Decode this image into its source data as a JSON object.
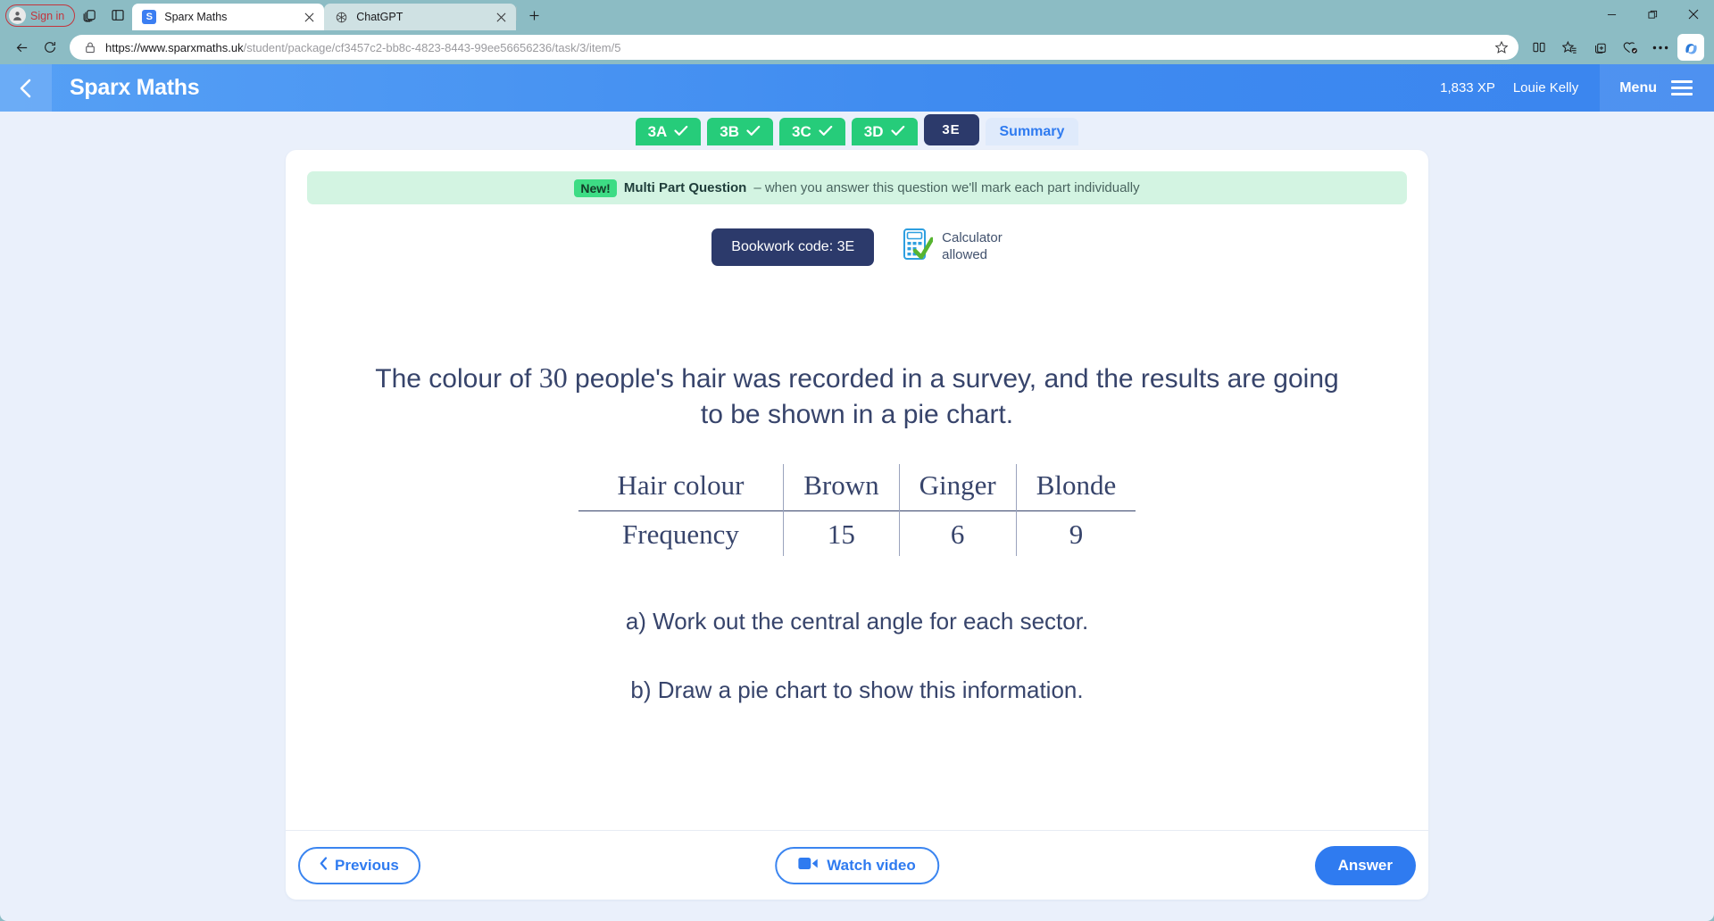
{
  "browser": {
    "signin_label": "Sign in",
    "tabs": [
      {
        "title": "Sparx Maths",
        "favicon": "sparx-s-icon",
        "active": true
      },
      {
        "title": "ChatGPT",
        "favicon": "openai-icon",
        "active": false
      }
    ],
    "url_secure": "https://www.sparxmaths.uk",
    "url_path": "/student/package/cf3457c2-bb8c-4823-8443-99ee56656236/task/3/item/5",
    "toolbar_icons": [
      "split-screen-icon",
      "favorites-icon",
      "collections-icon",
      "browser-essentials-icon",
      "more-options-icon",
      "copilot-icon"
    ],
    "window_controls": [
      "minimize-icon",
      "restore-icon",
      "close-icon"
    ]
  },
  "app": {
    "title": "Sparx Maths",
    "xp": "1,833 XP",
    "user": "Louie Kelly",
    "menu_label": "Menu"
  },
  "task_tabs": [
    {
      "label": "3A",
      "state": "done"
    },
    {
      "label": "3B",
      "state": "done"
    },
    {
      "label": "3C",
      "state": "done"
    },
    {
      "label": "3D",
      "state": "done"
    },
    {
      "label": "3E",
      "state": "current"
    },
    {
      "label": "Summary",
      "state": "summary"
    }
  ],
  "banner": {
    "pill": "New!",
    "strong": "Multi Part Question",
    "rest": "– when you answer this question we'll mark each part individually"
  },
  "bookwork": {
    "label": "Bookwork code: 3E",
    "calculator_line1": "Calculator",
    "calculator_line2": "allowed"
  },
  "question": {
    "line1_pre": "The colour of ",
    "line1_num": "30",
    "line1_post": " people's hair was recorded in a survey, and the results",
    "line2": "are going to be shown in a pie chart.",
    "part_a": "a) Work out the central angle for each sector.",
    "part_b": "b) Draw a pie chart to show this information."
  },
  "chart_data": {
    "type": "table",
    "title": "Hair colour frequency",
    "row_headers": [
      "Hair colour",
      "Frequency"
    ],
    "categories": [
      "Brown",
      "Ginger",
      "Blonde"
    ],
    "values": [
      15,
      6,
      9
    ],
    "total": 30
  },
  "footer": {
    "previous": "Previous",
    "watch_video": "Watch video",
    "answer": "Answer"
  },
  "colors": {
    "header_blue": "#3f8bf0",
    "accent_blue": "#2f7bf0",
    "navy": "#2c3a6b",
    "green": "#26cc7a",
    "banner_green": "#d3f4e2",
    "page_bg": "#eaf0fb"
  }
}
